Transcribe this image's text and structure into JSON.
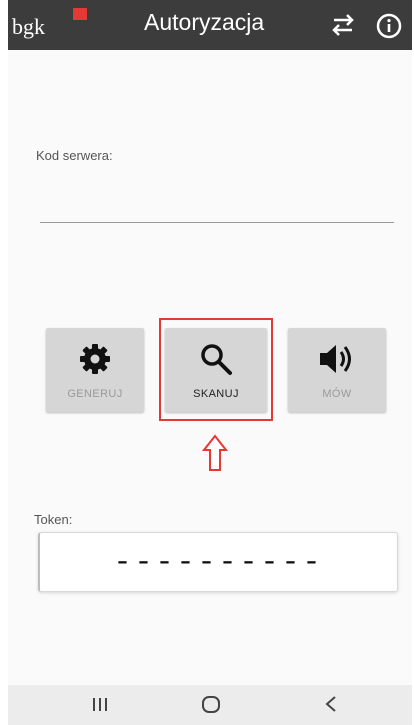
{
  "appbar": {
    "logo_text": "bgk",
    "title": "Autoryzacja",
    "icons": [
      "swap-arrows-icon",
      "info-icon"
    ]
  },
  "server": {
    "label": "Kod serwera:",
    "value": ""
  },
  "actions": [
    {
      "label": "GENERUJ",
      "icon": "gear-icon",
      "enabled": false
    },
    {
      "label": "SKANUJ",
      "icon": "magnifier-icon",
      "enabled": true
    },
    {
      "label": "MÓW",
      "icon": "speaker-icon",
      "enabled": false
    }
  ],
  "token": {
    "label": "Token:",
    "value": "----------"
  },
  "colors": {
    "appbar": "#3c3c3c",
    "highlight": "#e53935",
    "button_bg": "#d6d6d6",
    "background": "#fafafa"
  },
  "navbar": {
    "icons": [
      "recent-apps-icon",
      "home-icon",
      "back-icon"
    ]
  }
}
